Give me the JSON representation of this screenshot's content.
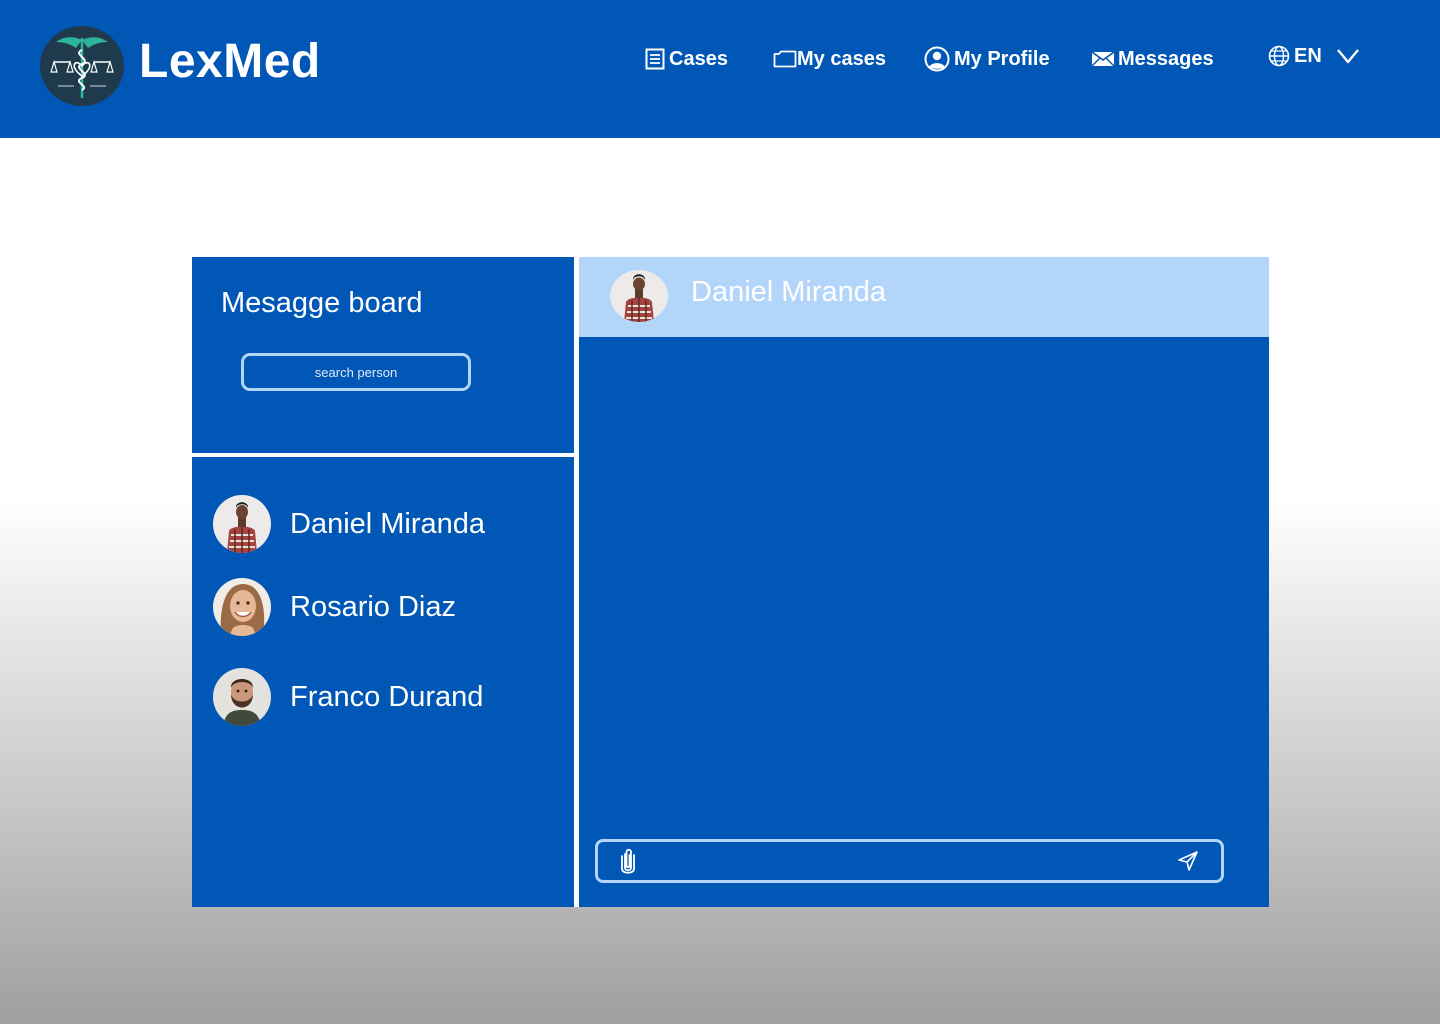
{
  "app": {
    "brand": "LexMed"
  },
  "nav": {
    "cases": "Cases",
    "my_cases": "My cases",
    "my_profile": "My Profile",
    "messages": "Messages",
    "language": "EN"
  },
  "board": {
    "title": "Mesagge board",
    "search_placeholder": "search person",
    "contacts": [
      {
        "name": "Daniel Miranda"
      },
      {
        "name": "Rosario Diaz"
      },
      {
        "name": "Franco Durand"
      }
    ]
  },
  "chat": {
    "active_contact": "Daniel Miranda",
    "message_value": ""
  },
  "colors": {
    "primary": "#0157b5",
    "chat_header": "#b3d5fa",
    "outline": "#b3d4fb",
    "white": "#ffffff"
  },
  "icons": {
    "cases": "document-list-icon",
    "my_cases": "folder-icon",
    "profile": "user-circle-icon",
    "messages": "envelope-icon",
    "language": "globe-icon",
    "dropdown": "chevron-down-icon",
    "attach": "paperclip-icon",
    "send": "send-icon"
  }
}
